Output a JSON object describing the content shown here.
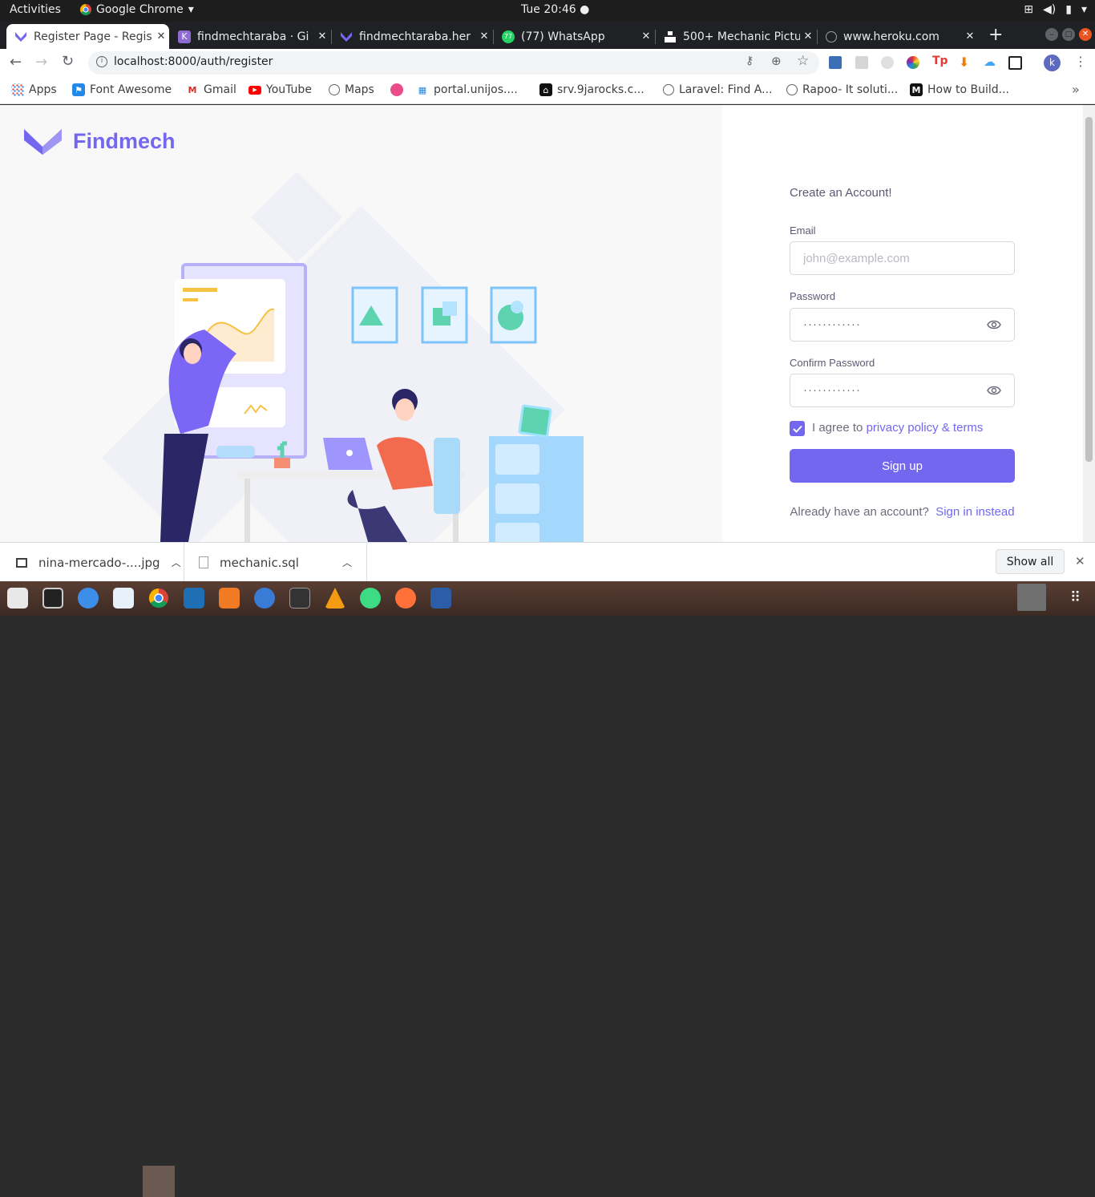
{
  "topbar": {
    "activities": "Activities",
    "app_name": "Google Chrome",
    "clock": "Tue 20:46"
  },
  "tabs": [
    {
      "title": "Register Page - Regis",
      "active": true
    },
    {
      "title": "findmechtaraba · Gi"
    },
    {
      "title": "findmechtaraba.her"
    },
    {
      "title": "(77) WhatsApp"
    },
    {
      "title": "500+ Mechanic Pictu"
    },
    {
      "title": "www.heroku.com"
    }
  ],
  "toolbar": {
    "url": "localhost:8000/auth/register",
    "profile_initial": "k"
  },
  "bookmarks": [
    {
      "label": "Apps"
    },
    {
      "label": "Font Awesome"
    },
    {
      "label": "Gmail"
    },
    {
      "label": "YouTube"
    },
    {
      "label": "Maps"
    },
    {
      "label": ""
    },
    {
      "label": "portal.unijos...."
    },
    {
      "label": "srv.9jarocks.c..."
    },
    {
      "label": "Laravel: Find A..."
    },
    {
      "label": "Rapoo- It soluti..."
    },
    {
      "label": "How to Build..."
    }
  ],
  "page": {
    "brand": "Findmech",
    "form_title": "Create an Account!",
    "email_label": "Email",
    "email_placeholder": "john@example.com",
    "password_label": "Password",
    "password_value": "············",
    "confirm_label": "Confirm Password",
    "confirm_value": "············",
    "agree_text": "I agree to",
    "agree_link": "privacy policy & terms",
    "signup": "Sign up",
    "already": "Already have an account?",
    "signin": "Sign in instead"
  },
  "downloads": [
    {
      "name": "nina-mercado-....jpg"
    },
    {
      "name": "mechanic.sql"
    }
  ],
  "show_all": "Show all",
  "colors": {
    "accent": "#7367f0"
  }
}
